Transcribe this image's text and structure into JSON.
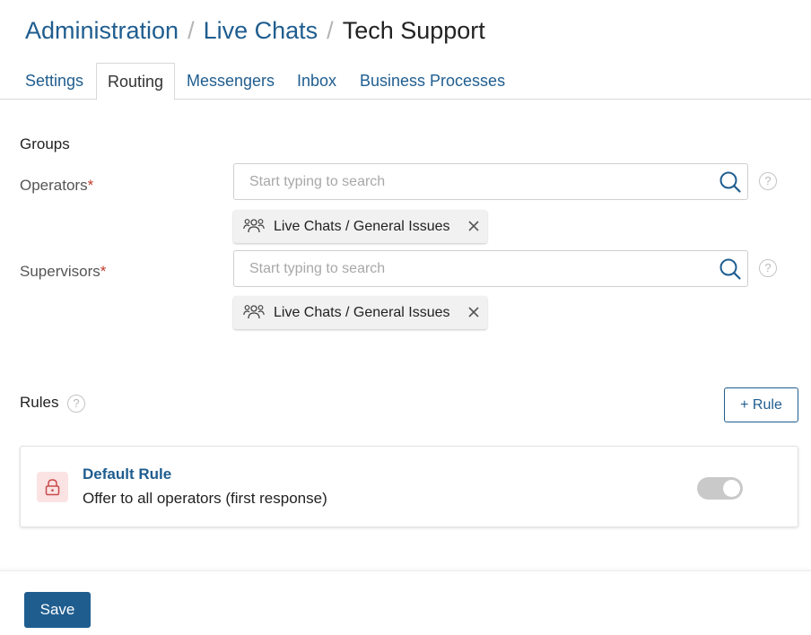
{
  "breadcrumb": {
    "items": [
      "Administration",
      "Live Chats",
      "Tech Support"
    ],
    "separator": "/"
  },
  "tabs": [
    {
      "label": "Settings",
      "active": false
    },
    {
      "label": "Routing",
      "active": true
    },
    {
      "label": "Messengers",
      "active": false
    },
    {
      "label": "Inbox",
      "active": false
    },
    {
      "label": "Business Processes",
      "active": false
    }
  ],
  "groups": {
    "title": "Groups",
    "operators": {
      "label": "Operators",
      "required_mark": "*",
      "placeholder": "Start typing to search",
      "value": "",
      "help": "?",
      "tags": [
        {
          "icon": "group-icon",
          "label": "Live Chats / General Issues"
        }
      ]
    },
    "supervisors": {
      "label": "Supervisors",
      "required_mark": "*",
      "placeholder": "Start typing to search",
      "value": "",
      "help": "?",
      "tags": [
        {
          "icon": "group-icon",
          "label": "Live Chats / General Issues"
        }
      ]
    }
  },
  "rules": {
    "title": "Rules",
    "help": "?",
    "add_label": "+ Rule",
    "items": [
      {
        "name": "Default Rule",
        "description": "Offer to all operators (first response)",
        "icon": "lock-icon",
        "enabled": true
      }
    ]
  },
  "footer": {
    "save_label": "Save"
  },
  "colors": {
    "accent": "#1f5d8f",
    "required": "#c0392b",
    "lock_bg": "#fbe3e3",
    "lock_icon": "#c94a4a",
    "toggle_track": "#c9c9c9"
  }
}
